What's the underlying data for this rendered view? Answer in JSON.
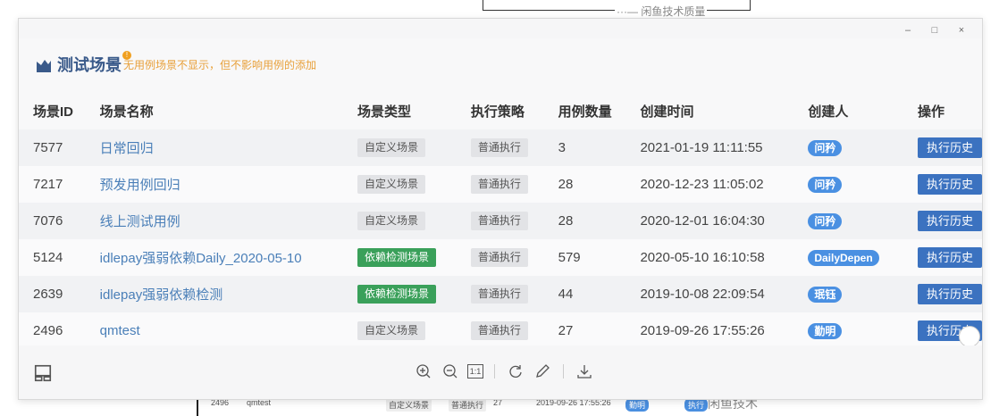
{
  "background": {
    "watermark_top": "···— 闲鱼技术质量",
    "bottom_row": {
      "id": "2496",
      "name": "qmtest",
      "type": "自定义场景",
      "strategy": "普通执行",
      "count": "27",
      "time": "2019-09-26 17:55:26",
      "creator": "勤明",
      "op": "执行"
    },
    "watermark_bottom": "闲鱼技术"
  },
  "window": {
    "minimize": "–",
    "maximize": "□",
    "close": "×"
  },
  "header": {
    "title": "测试场景",
    "info_badge": "!",
    "note": "无用例场景不显示，但不影响用例的添加"
  },
  "table": {
    "columns": [
      "场景ID",
      "场景名称",
      "场景类型",
      "执行策略",
      "用例数量",
      "创建时间",
      "创建人",
      "操作"
    ],
    "rows": [
      {
        "id": "7577",
        "name": "日常回归",
        "type": "自定义场景",
        "type_style": "gray",
        "strategy": "普通执行",
        "count": "3",
        "time": "2021-01-19 11:11:55",
        "creator": "问矜",
        "op": "执行历史"
      },
      {
        "id": "7217",
        "name": "预发用例回归",
        "type": "自定义场景",
        "type_style": "gray",
        "strategy": "普通执行",
        "count": "28",
        "time": "2020-12-23 11:05:02",
        "creator": "问矜",
        "op": "执行历史"
      },
      {
        "id": "7076",
        "name": "线上测试用例",
        "type": "自定义场景",
        "type_style": "gray",
        "strategy": "普通执行",
        "count": "28",
        "time": "2020-12-01 16:04:30",
        "creator": "问矜",
        "op": "执行历史"
      },
      {
        "id": "5124",
        "name": "idlepay强弱依赖Daily_2020-05-10",
        "type": "依赖检测场景",
        "type_style": "green",
        "strategy": "普通执行",
        "count": "579",
        "time": "2020-05-10 16:10:58",
        "creator": "DailyDepen",
        "op": "执行历史"
      },
      {
        "id": "2639",
        "name": "idlepay强弱依赖检测",
        "type": "依赖检测场景",
        "type_style": "green",
        "strategy": "普通执行",
        "count": "44",
        "time": "2019-10-08 22:09:54",
        "creator": "珉钰",
        "op": "执行历史"
      },
      {
        "id": "2496",
        "name": "qmtest",
        "type": "自定义场景",
        "type_style": "gray",
        "strategy": "普通执行",
        "count": "27",
        "time": "2019-09-26 17:55:26",
        "creator": "勤明",
        "op": "执行历史"
      }
    ]
  },
  "toolbar": {
    "actual_size_label": "1:1"
  },
  "colors": {
    "title": "#3a5a8a",
    "note": "#e8a03a",
    "link": "#4a7fb8",
    "green_tag": "#3aa05a",
    "creator_pill": "#4a90e2",
    "op_button": "#3b72c0"
  }
}
